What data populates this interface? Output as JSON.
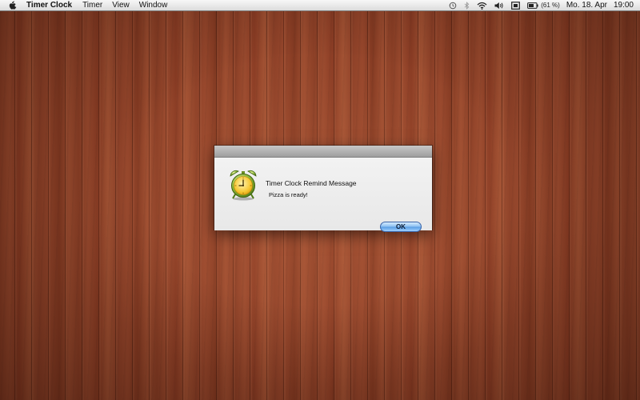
{
  "menubar": {
    "app_name": "Timer Clock",
    "menus": [
      "Timer",
      "View",
      "Window"
    ],
    "status": {
      "icons": [
        "time-machine-icon",
        "bluetooth-icon",
        "wifi-icon",
        "volume-icon",
        "display-icon",
        "battery-icon"
      ],
      "battery_percent": "(61 %)",
      "date": "Mo. 18. Apr",
      "time": "19:00"
    }
  },
  "dialog": {
    "title": "Timer Clock Remind Message",
    "message": "Pizza is ready!",
    "ok_label": "OK",
    "icon": "alarm-clock-icon"
  },
  "colors": {
    "menubar_bg": "#e9e9e9",
    "desktop_wood": "#8b3f26",
    "ok_button": "#7fb6ec"
  }
}
